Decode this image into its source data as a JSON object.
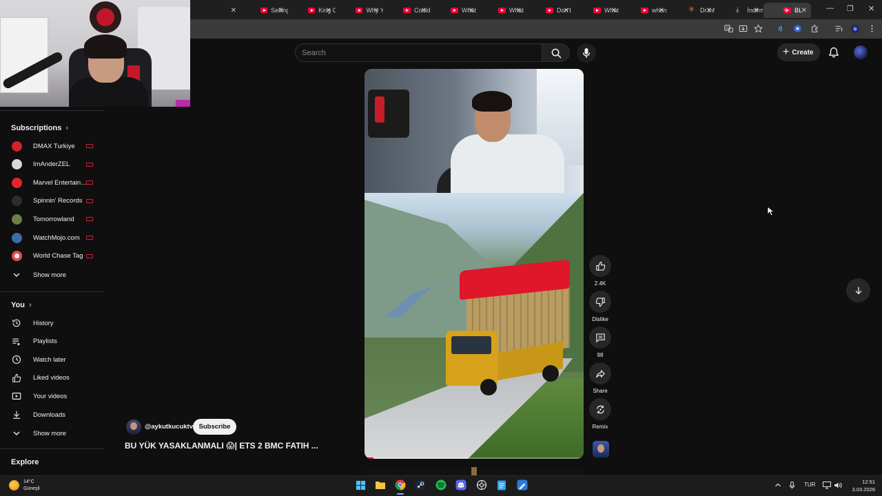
{
  "browser": {
    "tabs": [
      {
        "title": "",
        "type": "youtube"
      },
      {
        "title": "Selling",
        "type": "youtube"
      },
      {
        "title": "King C",
        "type": "youtube"
      },
      {
        "title": "Why Y",
        "type": "youtube"
      },
      {
        "title": "Could",
        "type": "youtube"
      },
      {
        "title": "What",
        "type": "youtube"
      },
      {
        "title": "What",
        "type": "youtube"
      },
      {
        "title": "Don't",
        "type": "youtube"
      },
      {
        "title": "What",
        "type": "youtube"
      },
      {
        "title": "when",
        "type": "youtube"
      },
      {
        "title": "Dr.inf",
        "type": "star"
      },
      {
        "title": "İndirm",
        "type": "download"
      },
      {
        "title": "BL",
        "type": "youtube",
        "active": true
      }
    ],
    "new_tab": "+",
    "window_controls": [
      "—",
      "❐",
      "✕"
    ]
  },
  "masthead": {
    "search_placeholder": "Search",
    "create_label": "Create",
    "icons": [
      "search-icon",
      "microphone-icon",
      "bell-icon",
      "avatar"
    ]
  },
  "sidebar": {
    "subscriptions_heading": "Subscriptions",
    "subscriptions": [
      {
        "label": "DMAX Turkiye",
        "color": "#d2232a",
        "live": true
      },
      {
        "label": "ImAnderZEL",
        "color": "#d8d8d8",
        "live": true
      },
      {
        "label": "Marvel Entertain...",
        "color": "#e62429",
        "live": true
      },
      {
        "label": "Spinnin' Records",
        "color": "#2d2d2d",
        "live": true
      },
      {
        "label": "Tomorrowland",
        "color": "#6c7f45",
        "live": true
      },
      {
        "label": "WatchMojo.com",
        "color": "#3a6ea5",
        "live": true
      },
      {
        "label": "World Chase Tag",
        "color": "#ffffff",
        "live": true
      }
    ],
    "show_more_1": "Show more",
    "you_heading": "You",
    "you_items": [
      {
        "label": "History",
        "icon": "history-icon"
      },
      {
        "label": "Playlists",
        "icon": "playlists-icon"
      },
      {
        "label": "Watch later",
        "icon": "watch-later-icon"
      },
      {
        "label": "Liked videos",
        "icon": "thumbs-up-icon"
      },
      {
        "label": "Your videos",
        "icon": "your-videos-icon"
      },
      {
        "label": "Downloads",
        "icon": "download-icon"
      }
    ],
    "show_more_2": "Show more",
    "explore_heading": "Explore"
  },
  "short": {
    "channel_handle": "@aykutkucuktv",
    "subscribe_label": "Subscribe",
    "title": "BU YÜK YASAKLANMALI 😱| ETS 2 BMC FATIH ...",
    "progress": 0.04,
    "actions": {
      "like_count": "2.4K",
      "dislike_label": "Dislike",
      "comment_count": "98",
      "share_label": "Share",
      "remix_label": "Remix"
    }
  },
  "taskbar": {
    "weather_temp": "14°C",
    "weather_desc": "Güneşli",
    "language": "TUR",
    "time": "12:51",
    "date": "3.03.2026"
  },
  "colors": {
    "background": "#0f0f0f",
    "accent": "#ff0033",
    "chip": "#272727"
  }
}
